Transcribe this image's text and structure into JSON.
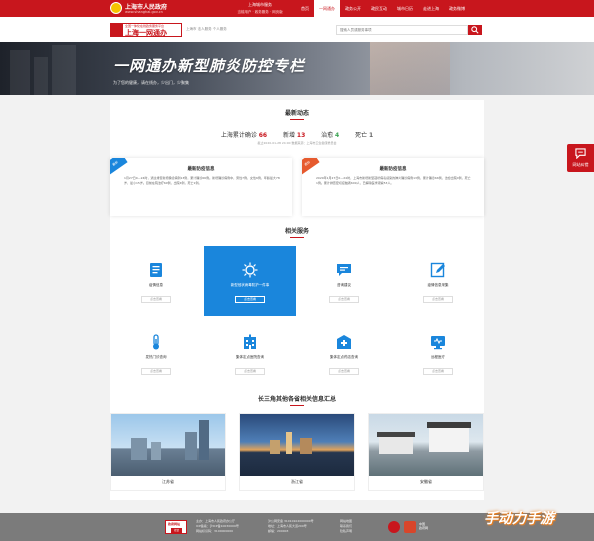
{
  "top_bar": {
    "gov_title": "上海市人民政府",
    "gov_url": "www.shanghai.gov.cn",
    "middle_title": "上海城市服务",
    "middle_sub": "当前用户 · 政务服务 · 网页版",
    "nav": [
      {
        "label": "首页",
        "active": false
      },
      {
        "label": "一网通办",
        "active": true
      },
      {
        "label": "政务公开",
        "active": false
      },
      {
        "label": "政民互动",
        "active": false
      },
      {
        "label": "城市日历",
        "active": false
      },
      {
        "label": "走进上海",
        "active": false
      },
      {
        "label": "政务微博",
        "active": false
      }
    ]
  },
  "brand_bar": {
    "brand_sub": "全国一体化在线政务服务平台",
    "brand_name": "上海一网通办",
    "location": "上海市  法人服务  个人服务",
    "search_placeholder": "搜索人员或服务事项"
  },
  "hero": {
    "title": "一网通办新型肺炎防控专栏",
    "subtitle": "为了您的健康，请在线办，少出门，少聚集"
  },
  "latest": {
    "title": "最新动态",
    "stats": [
      {
        "label": "上海累计确诊",
        "value": "66",
        "color": "#c8161d"
      },
      {
        "label": "新增",
        "value": "13",
        "color": "#c8161d"
      },
      {
        "label": "治愈",
        "value": "4",
        "color": "#3aa351"
      },
      {
        "label": "死亡",
        "value": "1",
        "color": "#666666"
      }
    ],
    "date": "截止2020-01-28 24:00 数据来源：上海市卫生健康委员会"
  },
  "cards": [
    {
      "badge": "最新",
      "badge_color": "#1a86dc",
      "title": "最新防疫信息",
      "body": "1月27日0—24时，通过排查新增确诊病例13例，累计确诊66例。新增确诊病例中，男性7例，女性6例，年龄最大78岁，最小15岁。目前在院治疗60例，出院4例，死亡1例。"
    },
    {
      "badge": "通知",
      "badge_color": "#e65a2e",
      "title": "最新防疫信息",
      "body": "2020年1月27日0—24时，上海市新增新型冠状病毒感染的肺炎确诊病例13例，累计确诊66例，治愈出院4例，死亡1例。累计排查密切接触者609人，已解除医学观察53人。"
    }
  ],
  "services": {
    "title": "相关服务",
    "go_label": "点击查看",
    "items": [
      {
        "label": "疫情信息",
        "icon": "document-list-icon"
      },
      {
        "label": "新型冠状病毒防护一件事",
        "icon": "virus-icon"
      },
      {
        "label": "咨询建议",
        "icon": "chat-icon"
      },
      {
        "label": "疫情信息采集",
        "icon": "edit-form-icon"
      },
      {
        "label": "发热门诊查询",
        "icon": "thermometer-icon"
      },
      {
        "label": "集体定点医院查询",
        "icon": "hospital-building-icon"
      },
      {
        "label": "集体定点药店查询",
        "icon": "pharmacy-icon"
      },
      {
        "label": "远程医疗",
        "icon": "monitor-icon"
      }
    ]
  },
  "regions": {
    "title": "长三角其他各省相关信息汇总",
    "items": [
      {
        "name": "江苏省"
      },
      {
        "name": "浙江省"
      },
      {
        "name": "安徽省"
      }
    ]
  },
  "footer": {
    "logo_top": "政府网站",
    "logo_bottom": "找错",
    "col1": [
      "主办：上海市人民政府办公厅",
      "ICP备案：沪ICP备10030000号",
      "网站标识码：3100000000"
    ],
    "col2": [
      "沪公网安备 31010102000000号",
      "地址：上海市人民大道200号",
      "邮编：200003"
    ],
    "col3": [
      "网站地图",
      "联系我们",
      "隐私声明"
    ],
    "emblem_text": [
      "中国",
      "政府网"
    ]
  },
  "feedback": {
    "label": "网站纠错"
  },
  "watermark": "手动力手游"
}
